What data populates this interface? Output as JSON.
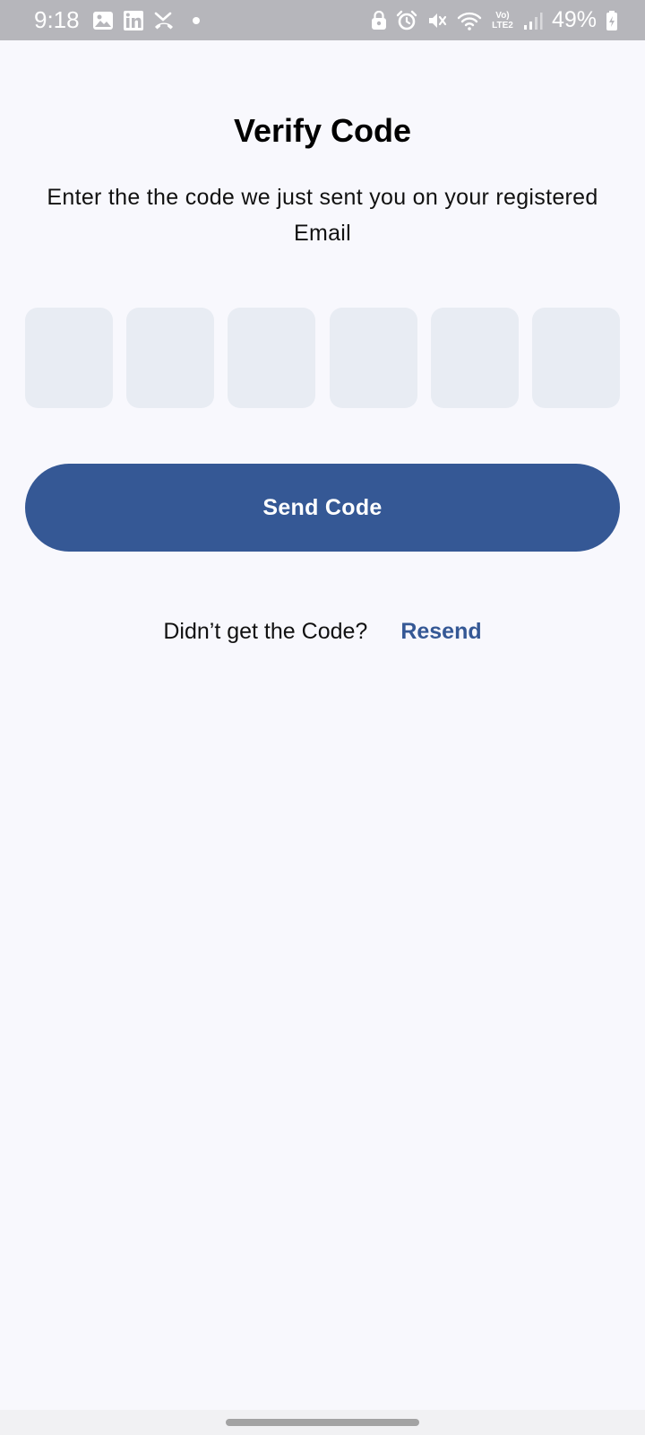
{
  "status_bar": {
    "time": "9:18",
    "network_label": "Vo) LTE2",
    "battery": "49%",
    "left_icons": [
      "image-icon",
      "linkedin-icon",
      "missed-call-icon"
    ],
    "right_icons": [
      "lock-icon",
      "alarm-icon",
      "mute-icon",
      "wifi-icon",
      "signal-icon",
      "battery-icon"
    ]
  },
  "page": {
    "title": "Verify Code",
    "subtitle": "Enter the the code we just sent you on your registered Email"
  },
  "code_inputs": {
    "count": 6,
    "values": [
      "",
      "",
      "",
      "",
      "",
      ""
    ]
  },
  "send_button": {
    "label": "Send Code"
  },
  "resend": {
    "prompt": "Didn’t get the Code?",
    "link_label": "Resend"
  },
  "colors": {
    "primary": "#355895",
    "background": "#f8f8fd",
    "input_fill": "#e8ecf3",
    "status_bar": "#b6b6bb"
  }
}
